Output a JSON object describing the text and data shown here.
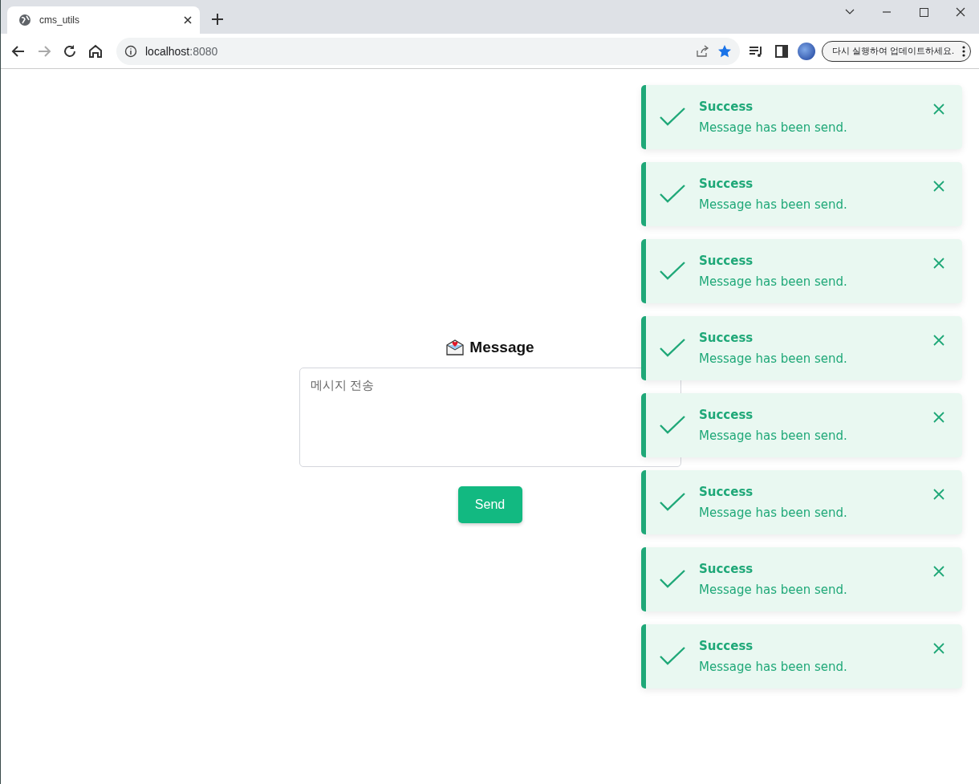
{
  "browser": {
    "tab": {
      "title": "cms_utils",
      "selected": true
    },
    "address": {
      "host": "localhost",
      "port": ":8080"
    },
    "update_button": "다시 실행하여 업데이트하세요."
  },
  "composer": {
    "title": "Message",
    "placeholder": "메시지 전송",
    "send_button": "Send"
  },
  "toasts": [
    {
      "kind": "success",
      "title": "Success",
      "message": "Message has been send."
    },
    {
      "kind": "success",
      "title": "Success",
      "message": "Message has been send."
    },
    {
      "kind": "success",
      "title": "Success",
      "message": "Message has been send."
    },
    {
      "kind": "success",
      "title": "Success",
      "message": "Message has been send."
    },
    {
      "kind": "success",
      "title": "Success",
      "message": "Message has been send."
    },
    {
      "kind": "success",
      "title": "Success",
      "message": "Message has been send."
    },
    {
      "kind": "success",
      "title": "Success",
      "message": "Message has been send."
    },
    {
      "kind": "success",
      "title": "Success",
      "message": "Message has been send."
    }
  ]
}
